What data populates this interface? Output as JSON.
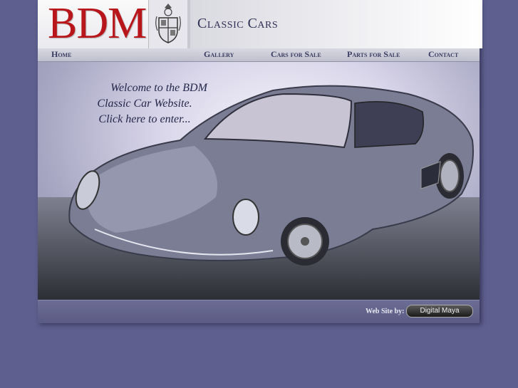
{
  "header": {
    "logo": "BDM",
    "site_title": "Classic Cars"
  },
  "nav": {
    "items": [
      {
        "label": "Home"
      },
      {
        "label": "Gallery"
      },
      {
        "label": "Cars for Sale"
      },
      {
        "label": "Parts for Sale"
      },
      {
        "label": "Contact"
      }
    ]
  },
  "hero": {
    "welcome_line1": "Welcome to the BDM",
    "welcome_line2": "Classic Car Website.",
    "welcome_line3": "Click here to enter...",
    "image": "classic-car-photo"
  },
  "footer": {
    "credit_label": "Web Site by:",
    "credit_badge": "Digital Maya"
  },
  "colors": {
    "page_background": "#5e5f8e",
    "logo_red": "#b8161b",
    "title_navy": "#2e2f55"
  }
}
